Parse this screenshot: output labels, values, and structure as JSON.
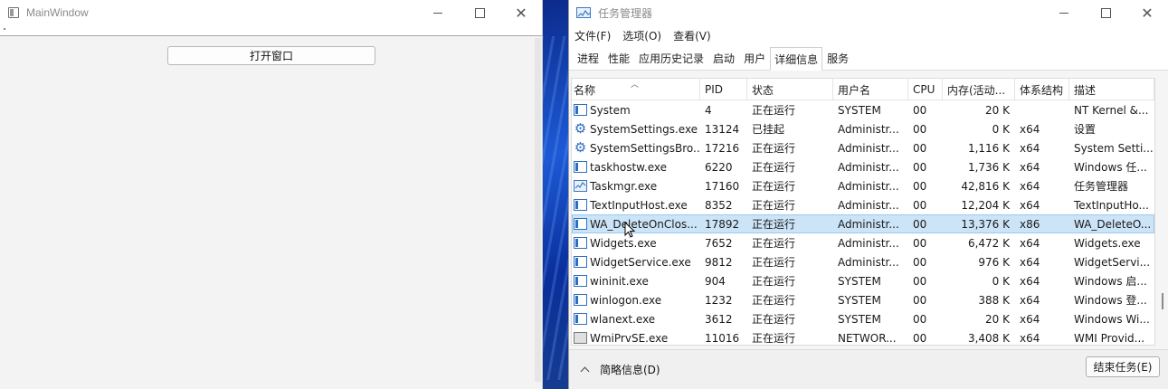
{
  "left_window": {
    "title": "MainWindow",
    "open_button_label": "打开窗口"
  },
  "task_manager": {
    "title": "任务管理器",
    "menu": [
      "文件(F)",
      "选项(O)",
      "查看(V)"
    ],
    "tabs": [
      "进程",
      "性能",
      "应用历史记录",
      "启动",
      "用户",
      "详细信息",
      "服务"
    ],
    "active_tab": "详细信息",
    "columns": [
      "名称",
      "PID",
      "状态",
      "用户名",
      "CPU",
      "内存(活动...",
      "体系结构",
      "描述"
    ],
    "rows": [
      {
        "icon": "window-icon",
        "name": "System",
        "pid": "4",
        "status": "正在运行",
        "user": "SYSTEM",
        "cpu": "00",
        "mem": "20 K",
        "arch": "",
        "desc": "NT Kernel &..."
      },
      {
        "icon": "gear-icon",
        "name": "SystemSettings.exe",
        "pid": "13124",
        "status": "已挂起",
        "user": "Administr...",
        "cpu": "00",
        "mem": "0 K",
        "arch": "x64",
        "desc": "设置"
      },
      {
        "icon": "gear-icon",
        "name": "SystemSettingsBro...",
        "pid": "17216",
        "status": "正在运行",
        "user": "Administr...",
        "cpu": "00",
        "mem": "1,116 K",
        "arch": "x64",
        "desc": "System Setti..."
      },
      {
        "icon": "window-icon",
        "name": "taskhostw.exe",
        "pid": "6220",
        "status": "正在运行",
        "user": "Administr...",
        "cpu": "00",
        "mem": "1,736 K",
        "arch": "x64",
        "desc": "Windows 任..."
      },
      {
        "icon": "chart-icon",
        "name": "Taskmgr.exe",
        "pid": "17160",
        "status": "正在运行",
        "user": "Administr...",
        "cpu": "00",
        "mem": "42,816 K",
        "arch": "x64",
        "desc": "任务管理器"
      },
      {
        "icon": "window-icon",
        "name": "TextInputHost.exe",
        "pid": "8352",
        "status": "正在运行",
        "user": "Administr...",
        "cpu": "00",
        "mem": "12,204 K",
        "arch": "x64",
        "desc": "TextInputHo..."
      },
      {
        "icon": "window-icon",
        "name": "WA_DeleteOnClos...",
        "pid": "17892",
        "status": "正在运行",
        "user": "Administr...",
        "cpu": "00",
        "mem": "13,376 K",
        "arch": "x86",
        "desc": "WA_DeleteO...",
        "selected": true
      },
      {
        "icon": "window-icon",
        "name": "Widgets.exe",
        "pid": "7652",
        "status": "正在运行",
        "user": "Administr...",
        "cpu": "00",
        "mem": "6,472 K",
        "arch": "x64",
        "desc": "Widgets.exe"
      },
      {
        "icon": "window-icon",
        "name": "WidgetService.exe",
        "pid": "9812",
        "status": "正在运行",
        "user": "Administr...",
        "cpu": "00",
        "mem": "976 K",
        "arch": "x64",
        "desc": "WidgetServi..."
      },
      {
        "icon": "window-icon",
        "name": "wininit.exe",
        "pid": "904",
        "status": "正在运行",
        "user": "SYSTEM",
        "cpu": "00",
        "mem": "0 K",
        "arch": "x64",
        "desc": "Windows 启..."
      },
      {
        "icon": "window-icon",
        "name": "winlogon.exe",
        "pid": "1232",
        "status": "正在运行",
        "user": "SYSTEM",
        "cpu": "00",
        "mem": "388 K",
        "arch": "x64",
        "desc": "Windows 登..."
      },
      {
        "icon": "window-icon",
        "name": "wlanext.exe",
        "pid": "3612",
        "status": "正在运行",
        "user": "SYSTEM",
        "cpu": "00",
        "mem": "20 K",
        "arch": "x64",
        "desc": "Windows Wi..."
      },
      {
        "icon": "service-icon",
        "name": "WmiPrvSE.exe",
        "pid": "11016",
        "status": "正在运行",
        "user": "NETWOR...",
        "cpu": "00",
        "mem": "3,408 K",
        "arch": "x64",
        "desc": "WMI Provid..."
      }
    ],
    "footer": {
      "fewer_details": "简略信息(D)",
      "end_task": "结束任务(E)"
    }
  }
}
